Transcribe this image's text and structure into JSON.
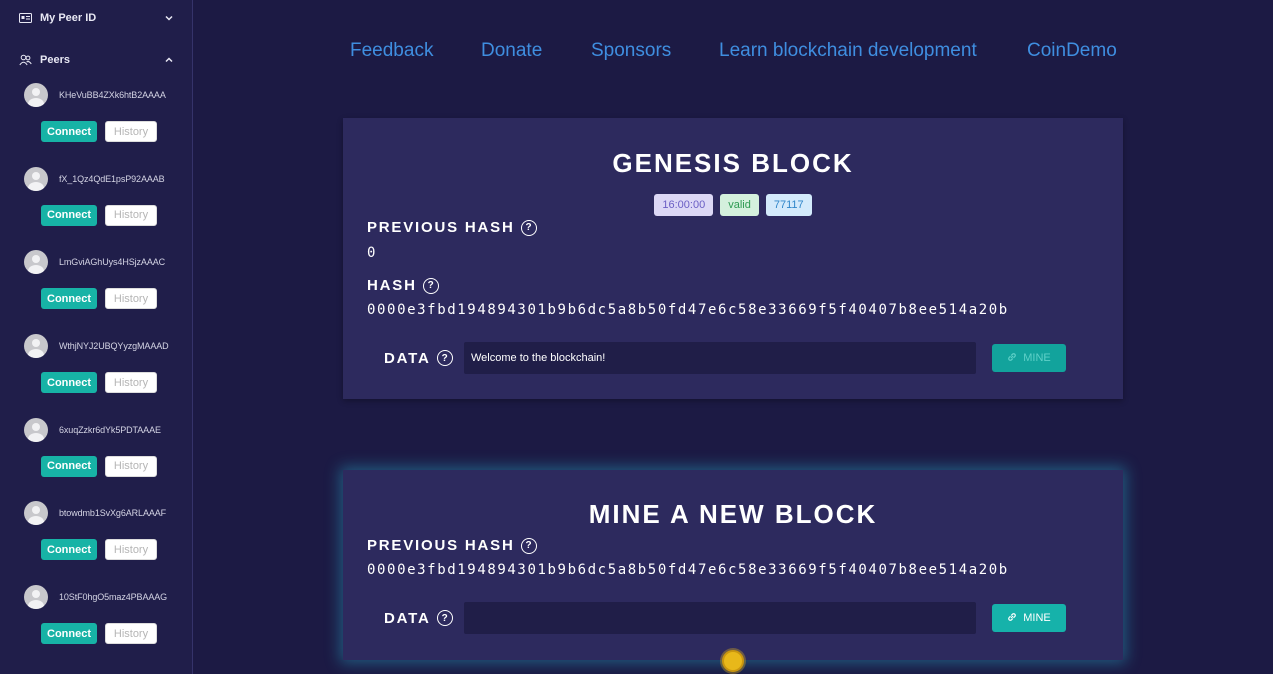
{
  "sidebar": {
    "my_peer_id": {
      "label": "My Peer ID"
    },
    "peers": {
      "label": "Peers",
      "items": [
        {
          "id": "KHeVuBB4ZXk6htB2AAAA",
          "connect": "Connect",
          "history": "History"
        },
        {
          "id": "fX_1Qz4QdE1psP92AAAB",
          "connect": "Connect",
          "history": "History"
        },
        {
          "id": "LmGviAGhUys4HSjzAAAC",
          "connect": "Connect",
          "history": "History"
        },
        {
          "id": "WthjNYJ2UBQYyzgMAAAD",
          "connect": "Connect",
          "history": "History"
        },
        {
          "id": "6xuqZzkr6dYk5PDTAAAE",
          "connect": "Connect",
          "history": "History"
        },
        {
          "id": "btowdmb1SvXg6ARLAAAF",
          "connect": "Connect",
          "history": "History"
        },
        {
          "id": "10StF0hgO5maz4PBAAAG",
          "connect": "Connect",
          "history": "History"
        }
      ]
    }
  },
  "nav": {
    "feedback": "Feedback",
    "donate": "Donate",
    "sponsors": "Sponsors",
    "learn": "Learn blockchain development",
    "coindemo": "CoinDemo"
  },
  "genesis": {
    "title": "GENESIS BLOCK",
    "badges": {
      "time": "16:00:00",
      "status": "valid",
      "nonce": "77117"
    },
    "previous_hash_label": "PREVIOUS HASH",
    "previous_hash": "0",
    "hash_label": "HASH",
    "hash": "0000e3fbd194894301b9b6dc5a8b50fd47e6c58e33669f5f40407b8ee514a20b",
    "data_label": "DATA",
    "data_value": "Welcome to the blockchain!",
    "mine_label": "MINE"
  },
  "new_block": {
    "title": "MINE A NEW BLOCK",
    "previous_hash_label": "PREVIOUS HASH",
    "previous_hash": "0000e3fbd194894301b9b6dc5a8b50fd47e6c58e33669f5f40407b8ee514a20b",
    "data_label": "DATA",
    "data_value": "",
    "mine_label": "MINE"
  },
  "colors": {
    "background": "#1c1a44",
    "sidebar": "#201e4a",
    "card": "#2d2a5e",
    "accent": "#17b3a6",
    "link": "#3f8ee0"
  }
}
